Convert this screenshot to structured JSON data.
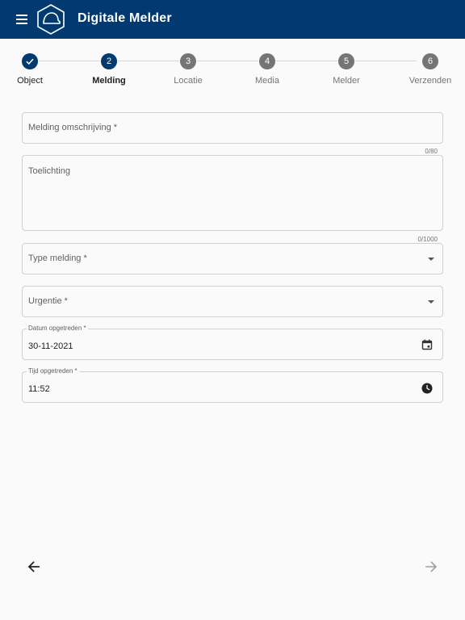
{
  "appbar": {
    "title": "Digitale Melder",
    "menu_icon": "hamburger-menu-icon",
    "logo_icon": "hexagon-helmet-logo"
  },
  "stepper": {
    "steps": [
      {
        "number": "",
        "label": "Object",
        "state": "done"
      },
      {
        "number": "2",
        "label": "Melding",
        "state": "active"
      },
      {
        "number": "3",
        "label": "Locatie",
        "state": "todo"
      },
      {
        "number": "4",
        "label": "Media",
        "state": "todo"
      },
      {
        "number": "5",
        "label": "Melder",
        "state": "todo"
      },
      {
        "number": "6",
        "label": "Verzenden",
        "state": "todo"
      }
    ]
  },
  "form": {
    "omschrijving": {
      "label": "Melding omschrijving *",
      "value": "",
      "counter": "0/80"
    },
    "toelichting": {
      "label": "Toelichting",
      "value": "",
      "counter": "0/1000"
    },
    "type_melding": {
      "label": "Type melding *",
      "value": ""
    },
    "urgentie": {
      "label": "Urgentie *",
      "value": ""
    },
    "datum": {
      "label": "Datum opgetreden *",
      "value": "30-11-2021",
      "icon": "calendar-icon"
    },
    "tijd": {
      "label": "Tijd opgetreden *",
      "value": "11:52",
      "icon": "clock-icon"
    }
  },
  "footer": {
    "back_icon": "arrow-back-icon",
    "next_icon": "arrow-forward-icon",
    "next_enabled": false
  },
  "colors": {
    "primary": "#003a70",
    "step_inactive": "#757575",
    "background": "#fafafa",
    "border": "#d0d0d0"
  }
}
